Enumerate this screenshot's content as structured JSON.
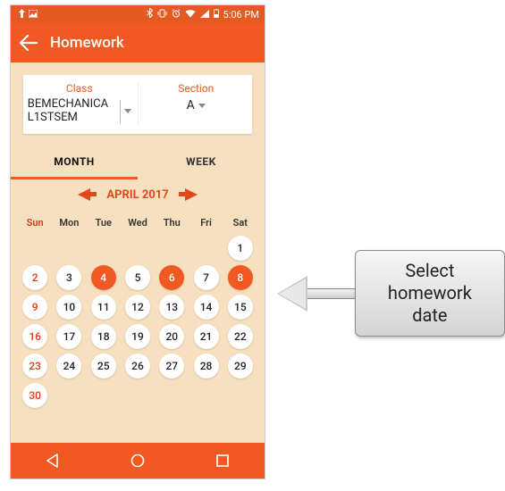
{
  "statusbar": {
    "time": "5:06 PM"
  },
  "appbar": {
    "title": "Homework"
  },
  "selector": {
    "class_label": "Class",
    "class_value": "BEMECHANICAL1STSEM",
    "section_label": "Section",
    "section_value": "A"
  },
  "tabs": {
    "month": "MONTH",
    "week": "WEEK",
    "active": "month"
  },
  "month_nav": {
    "label": "APRIL 2017"
  },
  "dow": [
    "Sun",
    "Mon",
    "Tue",
    "Wed",
    "Thu",
    "Fri",
    "Sat"
  ],
  "calendar": {
    "rows": [
      [
        null,
        null,
        null,
        null,
        null,
        null,
        {
          "n": 1
        }
      ],
      [
        {
          "n": 2,
          "sun": true
        },
        {
          "n": 3
        },
        {
          "n": 4,
          "today": true
        },
        {
          "n": 5
        },
        {
          "n": 6,
          "today": true
        },
        {
          "n": 7
        },
        {
          "n": 8,
          "today": true
        }
      ],
      [
        {
          "n": 9,
          "sun": true
        },
        {
          "n": 10
        },
        {
          "n": 11
        },
        {
          "n": 12
        },
        {
          "n": 13
        },
        {
          "n": 14
        },
        {
          "n": 15
        }
      ],
      [
        {
          "n": 16,
          "sun": true
        },
        {
          "n": 17
        },
        {
          "n": 18
        },
        {
          "n": 19
        },
        {
          "n": 20
        },
        {
          "n": 21
        },
        {
          "n": 22
        }
      ],
      [
        {
          "n": 23,
          "sun": true
        },
        {
          "n": 24
        },
        {
          "n": 25
        },
        {
          "n": 26
        },
        {
          "n": 27
        },
        {
          "n": 28
        },
        {
          "n": 29
        }
      ],
      [
        {
          "n": 30,
          "sun": true
        },
        null,
        null,
        null,
        null,
        null,
        null
      ]
    ]
  },
  "callout": {
    "line1": "Select",
    "line2": "homework date"
  }
}
